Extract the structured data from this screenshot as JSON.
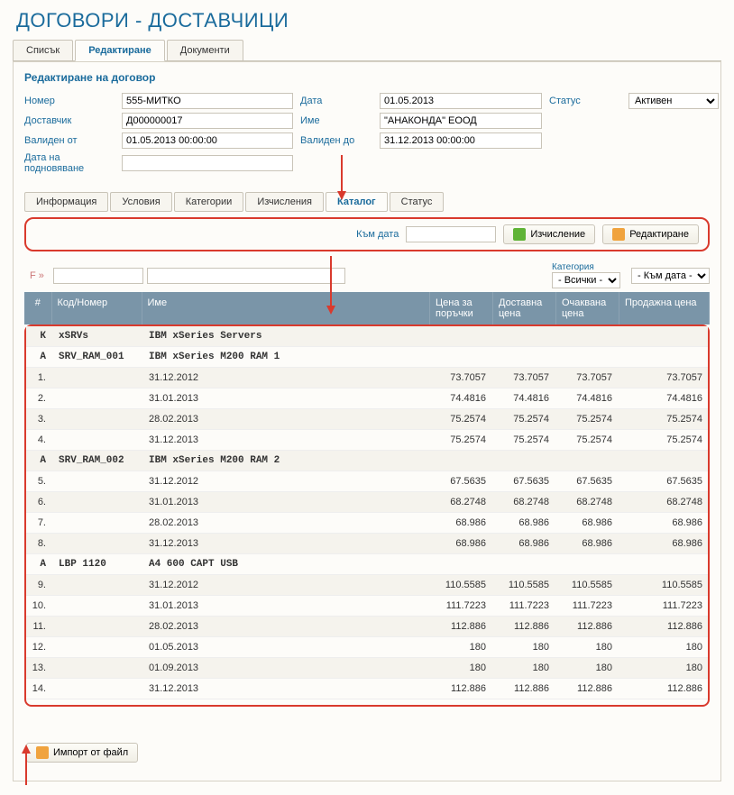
{
  "page_title": "ДОГОВОРИ - ДОСТАВЧИЦИ",
  "main_tabs": {
    "list": "Списък",
    "edit": "Редактиране",
    "docs": "Документи"
  },
  "section_title": "Редактиране на договор",
  "form": {
    "number_label": "Номер",
    "number": "555-МИТКО",
    "date_label": "Дата",
    "date": "01.05.2013",
    "status_label": "Статус",
    "status": "Активен",
    "supplier_label": "Доставчик",
    "supplier": "Д000000017",
    "name_label": "Име",
    "name": "\"АНАКОНДА\" ЕООД",
    "valid_from_label": "Валиден от",
    "valid_from": "01.05.2013 00:00:00",
    "valid_to_label": "Валиден до",
    "valid_to": "31.12.2013 00:00:00",
    "renew_label": "Дата на подновяване",
    "renew": ""
  },
  "sub_tabs": {
    "info": "Информация",
    "cond": "Условия",
    "cat": "Категории",
    "calc": "Изчисления",
    "catalog": "Каталог",
    "status": "Статус"
  },
  "toolbar": {
    "to_date": "Към дата",
    "calc": "Изчисление",
    "edit": "Редактиране"
  },
  "filter": {
    "f": "F »",
    "cat_label": "Категория",
    "cat_value": "- Всички -",
    "date_value": "- Към дата -"
  },
  "columns": {
    "idx": "#",
    "code": "Код/Номер",
    "name": "Име",
    "order_price": "Цена за поръчки",
    "supply_price": "Доставна цена",
    "expect_price": "Очаквана цена",
    "sale_price": "Продажна цена"
  },
  "rows": [
    {
      "type": "group",
      "idx": "К",
      "code": "xSRVs",
      "name": "IBM xSeries Servers"
    },
    {
      "type": "group",
      "idx": "А",
      "code": "SRV_RAM_001",
      "name": "IBM xSeries M200 RAM 1"
    },
    {
      "type": "data",
      "idx": "1.",
      "name": "31.12.2012",
      "p1": "73.7057",
      "p2": "73.7057",
      "p3": "73.7057",
      "p4": "73.7057"
    },
    {
      "type": "data",
      "idx": "2.",
      "name": "31.01.2013",
      "p1": "74.4816",
      "p2": "74.4816",
      "p3": "74.4816",
      "p4": "74.4816"
    },
    {
      "type": "data",
      "idx": "3.",
      "name": "28.02.2013",
      "p1": "75.2574",
      "p2": "75.2574",
      "p3": "75.2574",
      "p4": "75.2574"
    },
    {
      "type": "data",
      "idx": "4.",
      "name": "31.12.2013",
      "p1": "75.2574",
      "p2": "75.2574",
      "p3": "75.2574",
      "p4": "75.2574"
    },
    {
      "type": "group",
      "idx": "А",
      "code": "SRV_RAM_002",
      "name": "IBM xSeries M200 RAM 2"
    },
    {
      "type": "data",
      "idx": "5.",
      "name": "31.12.2012",
      "p1": "67.5635",
      "p2": "67.5635",
      "p3": "67.5635",
      "p4": "67.5635"
    },
    {
      "type": "data",
      "idx": "6.",
      "name": "31.01.2013",
      "p1": "68.2748",
      "p2": "68.2748",
      "p3": "68.2748",
      "p4": "68.2748"
    },
    {
      "type": "data",
      "idx": "7.",
      "name": "28.02.2013",
      "p1": "68.986",
      "p2": "68.986",
      "p3": "68.986",
      "p4": "68.986"
    },
    {
      "type": "data",
      "idx": "8.",
      "name": "31.12.2013",
      "p1": "68.986",
      "p2": "68.986",
      "p3": "68.986",
      "p4": "68.986"
    },
    {
      "type": "group",
      "idx": "А",
      "code": "LBP 1120",
      "name": "A4 600 CAPT USB"
    },
    {
      "type": "data",
      "idx": "9.",
      "name": "31.12.2012",
      "p1": "110.5585",
      "p2": "110.5585",
      "p3": "110.5585",
      "p4": "110.5585"
    },
    {
      "type": "data",
      "idx": "10.",
      "name": "31.01.2013",
      "p1": "111.7223",
      "p2": "111.7223",
      "p3": "111.7223",
      "p4": "111.7223"
    },
    {
      "type": "data",
      "idx": "11.",
      "name": "28.02.2013",
      "p1": "112.886",
      "p2": "112.886",
      "p3": "112.886",
      "p4": "112.886"
    },
    {
      "type": "data",
      "idx": "12.",
      "name": "01.05.2013",
      "p1": "180",
      "p2": "180",
      "p3": "180",
      "p4": "180"
    },
    {
      "type": "data",
      "idx": "13.",
      "name": "01.09.2013",
      "p1": "180",
      "p2": "180",
      "p3": "180",
      "p4": "180"
    },
    {
      "type": "data",
      "idx": "14.",
      "name": "31.12.2013",
      "p1": "112.886",
      "p2": "112.886",
      "p3": "112.886",
      "p4": "112.886"
    }
  ],
  "import_btn": "Импорт от файл"
}
